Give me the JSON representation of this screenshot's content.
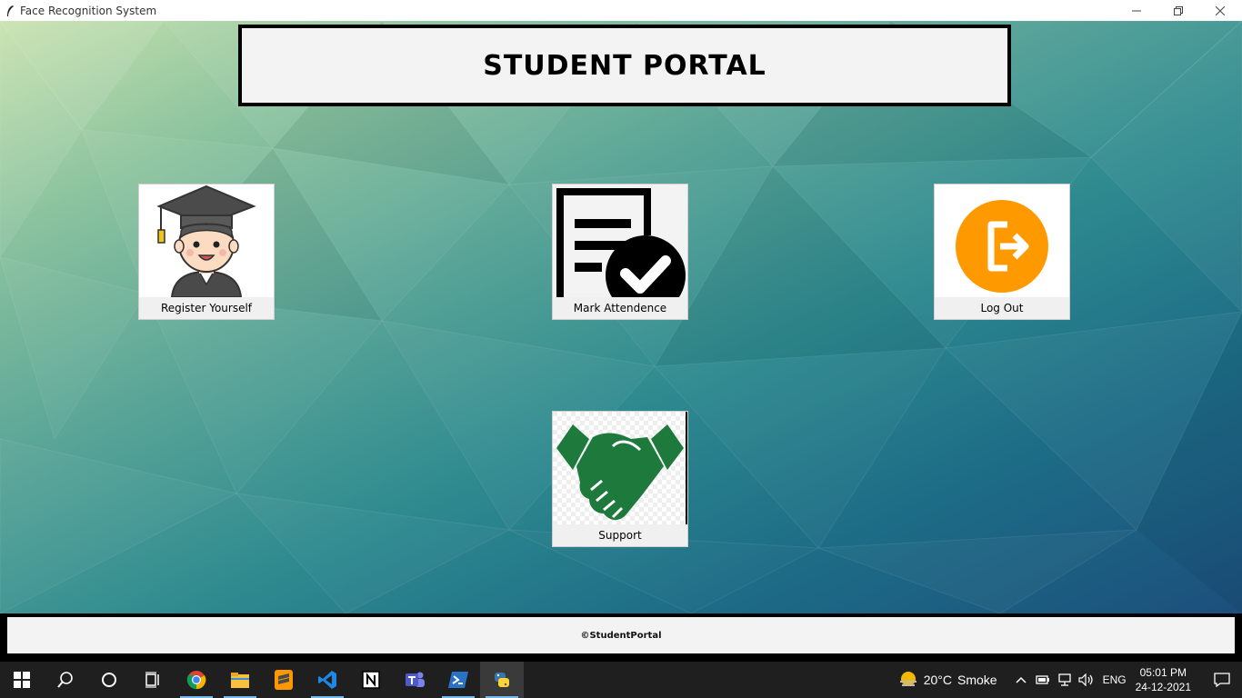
{
  "window": {
    "title": "Face Recognition System"
  },
  "header": {
    "title": "STUDENT PORTAL"
  },
  "tiles": {
    "register": {
      "label": "Register Yourself"
    },
    "attendance": {
      "label": "Mark Attendence"
    },
    "logout": {
      "label": "Log Out"
    },
    "support": {
      "label": "Support"
    }
  },
  "footer": {
    "text": "©StudentPortal"
  },
  "taskbar": {
    "apps": [
      "start-icon",
      "search-icon",
      "cortana-icon",
      "task-view-icon",
      "chrome-icon",
      "file-explorer-icon",
      "sublime-text-icon",
      "vscode-icon",
      "notion-icon",
      "teams-icon",
      "powershell-icon",
      "python-icon"
    ],
    "weather": {
      "temp": "20°C",
      "condition": "Smoke"
    },
    "language": "ENG",
    "time": "05:01 PM",
    "date": "24-12-2021"
  },
  "colors": {
    "logout_orange": "#FF9900",
    "support_green": "#1E7A3C",
    "header_bg": "#F3F3F3",
    "taskbar": "#1F1F1F"
  }
}
